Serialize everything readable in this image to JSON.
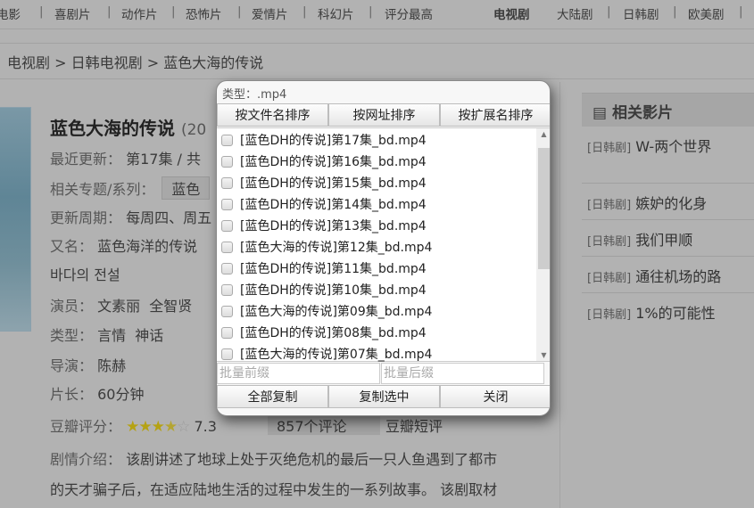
{
  "nav": {
    "items": [
      "电影",
      "喜剧片",
      "动作片",
      "恐怖片",
      "爱情片",
      "科幻片",
      "评分最高"
    ],
    "tv": "电视剧",
    "tv_items": [
      "大陆剧",
      "日韩剧",
      "欧美剧"
    ]
  },
  "breadcrumb": [
    "电视剧",
    "日韩电视剧",
    "蓝色大海的传说"
  ],
  "detail": {
    "title": "蓝色大海的传说",
    "year_partial": "(20",
    "latest_label": "最近更新：",
    "latest": "第17集 / 共",
    "series_label": "相关专题/系列：",
    "series": "蓝色",
    "cycle_label": "更新周期：",
    "cycle": "每周四、周五",
    "alias_label": "又名：",
    "alias": "蓝色海洋的传说",
    "alias_ko": "바다의 전설",
    "actors_label": "演员：",
    "actors": [
      "文素丽",
      "全智贤"
    ],
    "genre_label": "类型：",
    "genres": [
      "言情",
      "神话"
    ],
    "director_label": "导演：",
    "director": "陈赫",
    "length_label": "片长：",
    "length": "60分钟",
    "rating_label": "豆瓣评分：",
    "rating": "7.3",
    "stars": 3.5,
    "comments": "857个评论",
    "douban_short": "豆瓣短评",
    "plot_label": "剧情介绍：",
    "plot_1": "该剧讲述了地球上处于灭绝危机的最后一只人鱼遇到了都市",
    "plot_2": "的天才骗子后，在适应陆地生活的过程中发生的一系列故事。 该剧取材"
  },
  "sidebar": {
    "title": "相关影片",
    "items": [
      {
        "cat": "[日韩剧]",
        "name": "W-两个世界"
      },
      {
        "cat": "[日韩剧]",
        "name": "嫉妒的化身"
      },
      {
        "cat": "[日韩剧]",
        "name": "我们甲顺"
      },
      {
        "cat": "[日韩剧]",
        "name": "通往机场的路"
      },
      {
        "cat": "[日韩剧]",
        "name": "1%的可能性"
      }
    ]
  },
  "dialog": {
    "type": "类型：.mp4",
    "sort": [
      "按文件名排序",
      "按网址排序",
      "按扩展名排序"
    ],
    "files": [
      "[蓝色DH的传说]第17集_bd.mp4",
      "[蓝色DH的传说]第16集_bd.mp4",
      "[蓝色DH的传说]第15集_bd.mp4",
      "[蓝色DH的传说]第14集_bd.mp4",
      "[蓝色DH的传说]第13集_bd.mp4",
      "[蓝色大海的传说]第12集_bd.mp4",
      "[蓝色DH的传说]第11集_bd.mp4",
      "[蓝色DH的传说]第10集_bd.mp4",
      "[蓝色大海的传说]第09集_bd.mp4",
      "[蓝色DH的传说]第08集_bd.mp4",
      "[蓝色大海的传说]第07集_bd.mp4"
    ],
    "prefix_placeholder": "批量前缀",
    "suffix_placeholder": "批量后缀",
    "actions": [
      "全部复制",
      "复制选中",
      "关闭"
    ]
  }
}
